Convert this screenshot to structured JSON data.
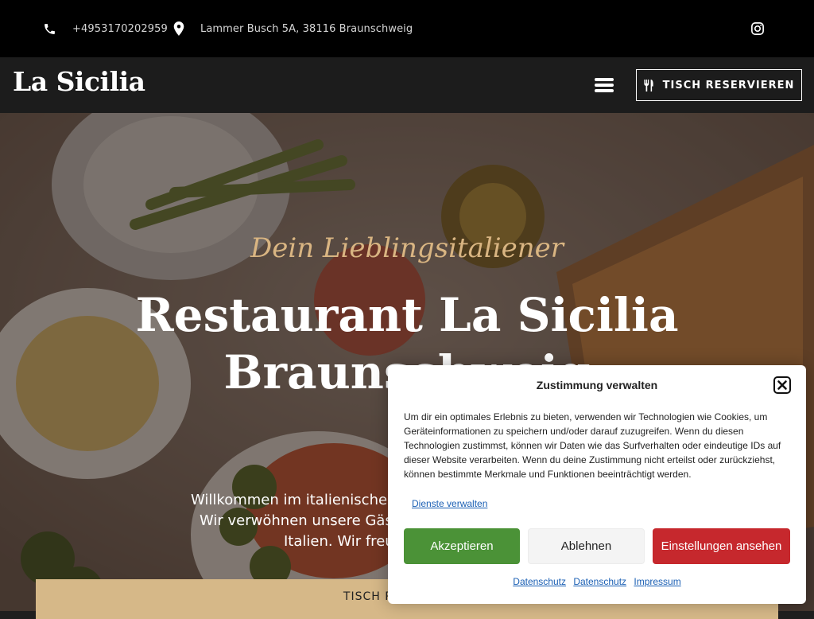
{
  "topbar": {
    "phone": "+4953170202959",
    "address": "Lammer Busch 5A, 38116 Braunschweig",
    "icons": [
      "phone-icon",
      "map-pin-icon",
      "instagram-icon"
    ]
  },
  "navbar": {
    "logo": "La Sicilia",
    "menu_icon": "hamburger-menu-icon",
    "reserve_label": "TISCH RESERVIEREN",
    "reserve_icon": "cutlery-icon"
  },
  "hero": {
    "tagline": "Dein Lieblingsitaliener",
    "title_line1": "Restaurant La Sicilia",
    "title_line2": "Braunschweig",
    "welcome_line1": "Willkommen im italienischen",
    "welcome_line2": "Wir verwöhnen unsere Gäst",
    "welcome_line3": "Italien. Wir freu",
    "button_label": "TISCH RESERVIEREN"
  },
  "consent": {
    "title": "Zustimmung verwalten",
    "text": "Um dir ein optimales Erlebnis zu bieten, verwenden wir Technologien wie Cookies, um Geräteinformationen zu speichern und/oder darauf zuzugreifen. Wenn du diesen Technologien zustimmst, können wir Daten wie das Surfverhalten oder eindeutige IDs auf dieser Website verarbeiten. Wenn du deine Zustimmung nicht erteilst oder zurückziehst, können bestimmte Merkmale und Funktionen beeinträchtigt werden.",
    "manage_label": "Dienste verwalten",
    "accept_label": "Akzeptieren",
    "deny_label": "Ablehnen",
    "prefs_label": "Einstellungen ansehen",
    "links": [
      "Datenschutz",
      "Datenschutz",
      "Impressum"
    ],
    "colors": {
      "accept": "#4b9237",
      "prefs": "#c6282d",
      "link": "#1a5fb4"
    }
  },
  "colors": {
    "accent_gold": "#d9b582",
    "button_gold": "#d6b888"
  }
}
